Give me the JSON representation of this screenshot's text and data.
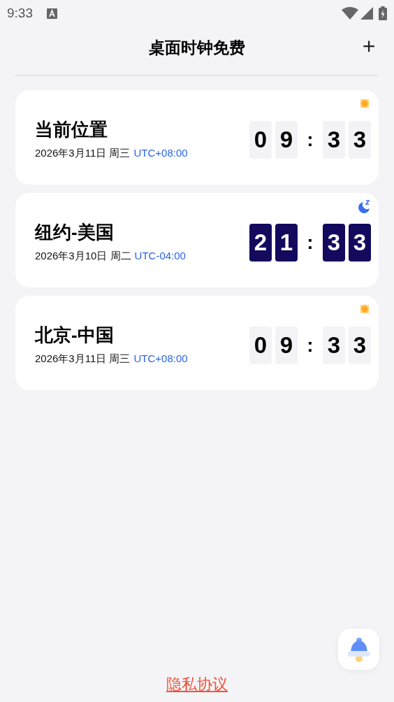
{
  "status_bar": {
    "time": "9:33"
  },
  "header": {
    "title": "桌面时钟免费",
    "add_button": "+"
  },
  "clocks": [
    {
      "name": "当前位置",
      "date": "2026年3月11日 周三",
      "offset": "UTC+08:00",
      "kind": "day",
      "digits": [
        "0",
        "9",
        "3",
        "3"
      ],
      "separator": ":"
    },
    {
      "name": "纽约-美国",
      "date": "2026年3月10日 周二",
      "offset": "UTC-04:00",
      "kind": "night",
      "digits": [
        "2",
        "1",
        "3",
        "3"
      ],
      "separator": ":"
    },
    {
      "name": "北京-中国",
      "date": "2026年3月11日 周三",
      "offset": "UTC+08:00",
      "kind": "day",
      "digits": [
        "0",
        "9",
        "3",
        "3"
      ],
      "separator": ":"
    }
  ],
  "footer": {
    "privacy_link": "隐私协议"
  }
}
